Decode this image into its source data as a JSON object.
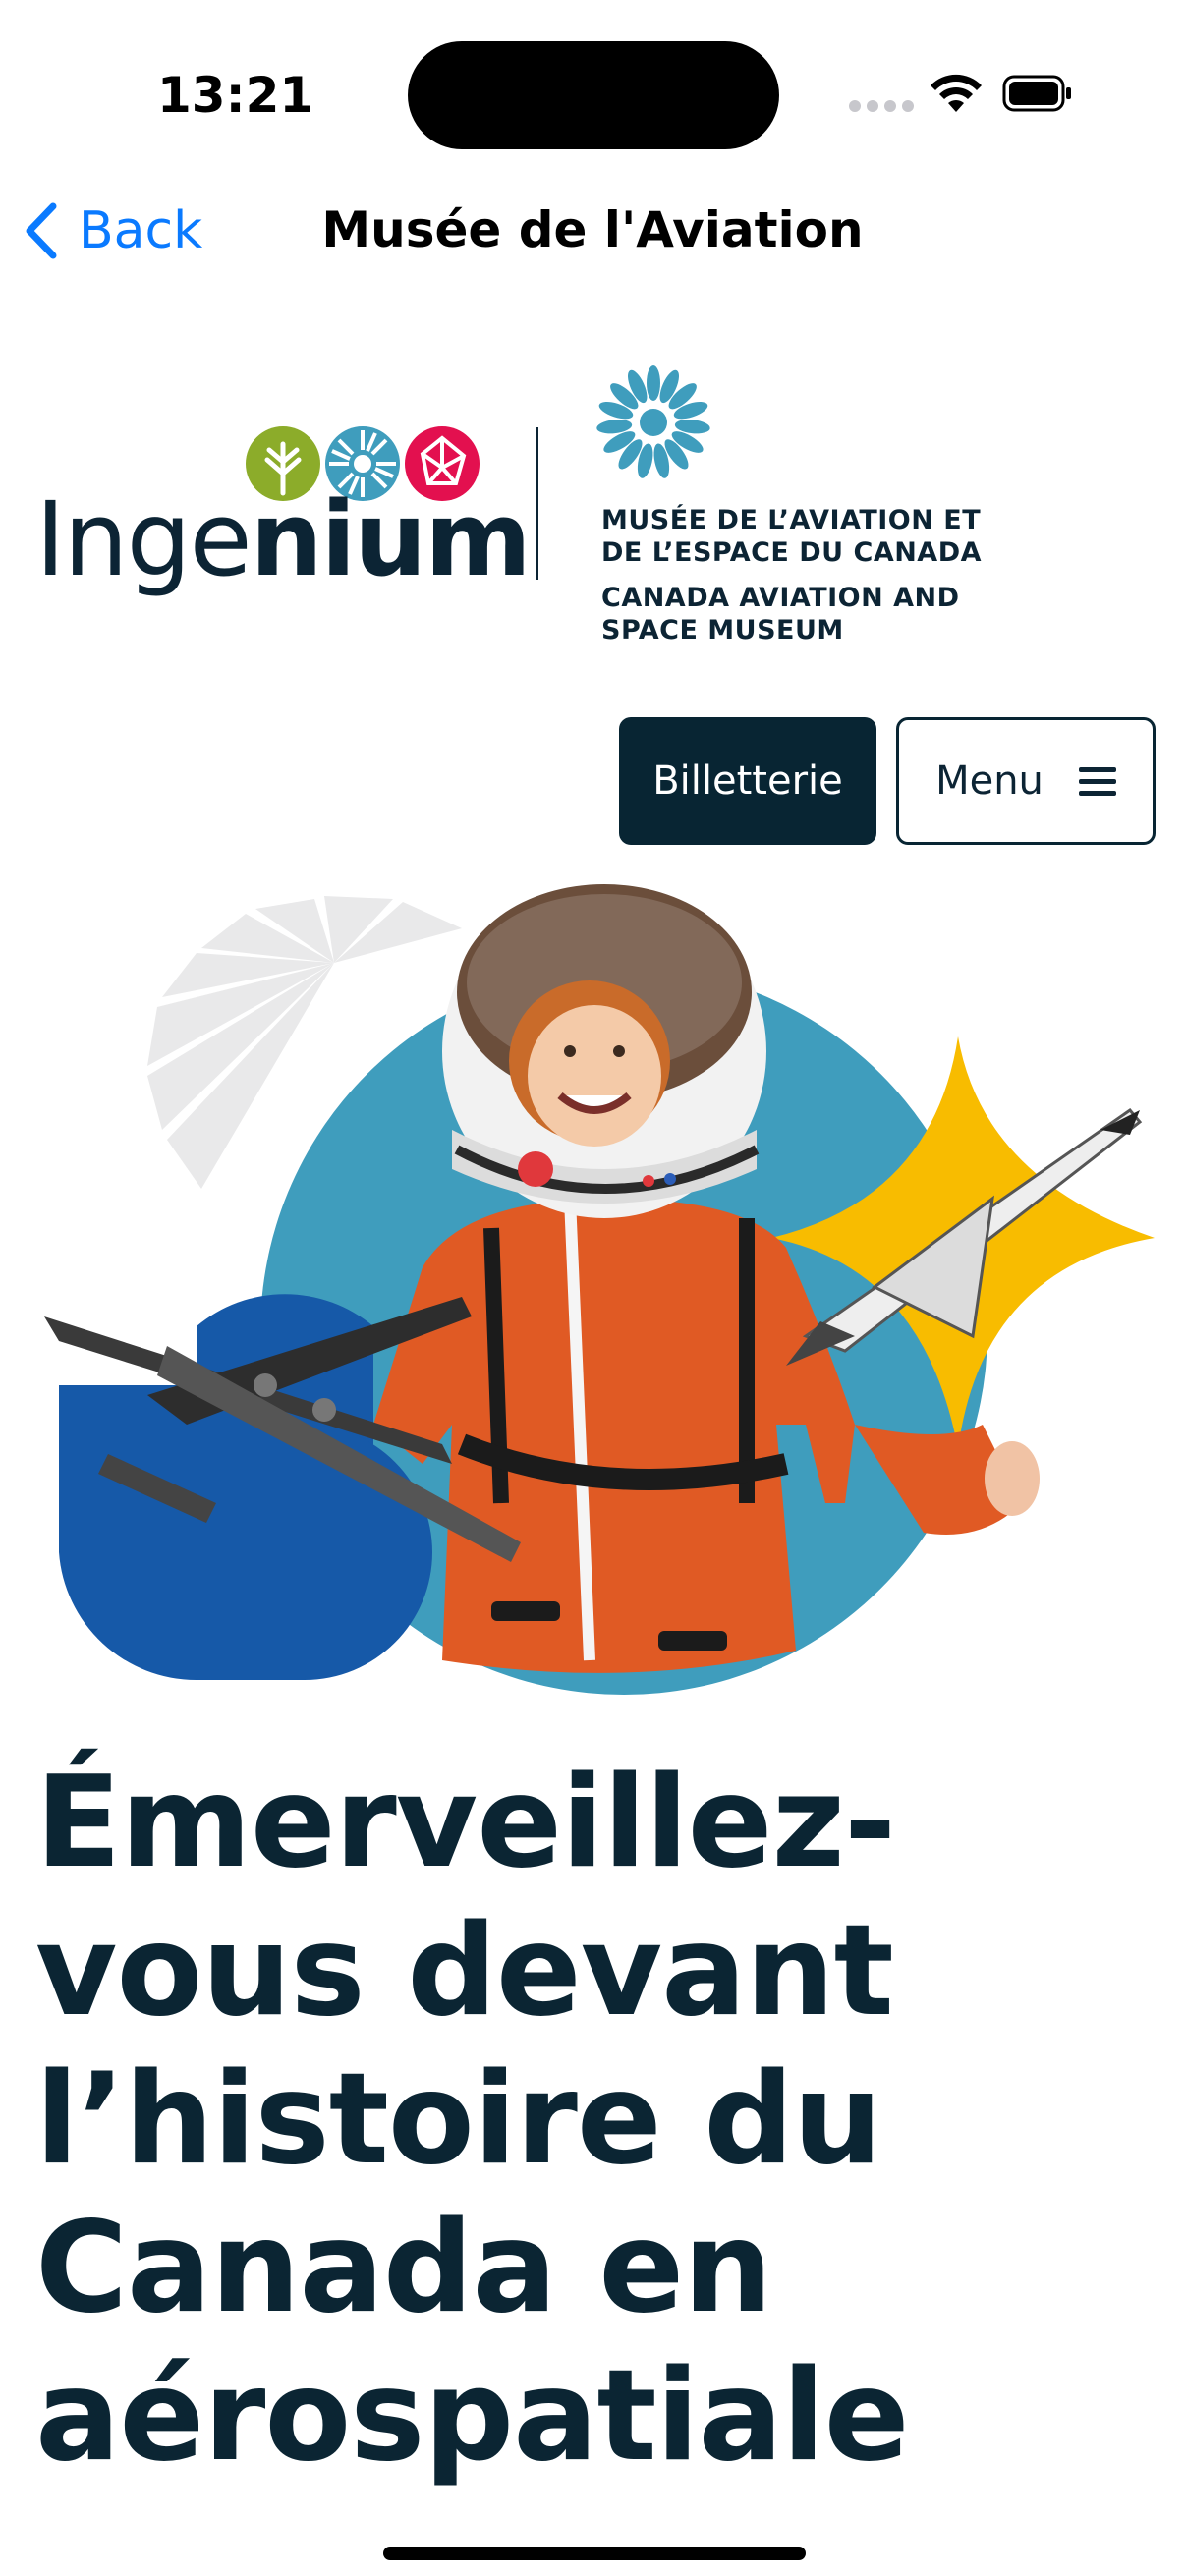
{
  "status_bar": {
    "time": "13:21"
  },
  "nav": {
    "back_label": "Back",
    "title": "Musée de l'Aviation"
  },
  "logo": {
    "ingenium_light": "Inge",
    "ingenium_bold": "nium",
    "museum_fr_line1": "MUSÉE DE L’AVIATION ET",
    "museum_fr_line2": "DE L’ESPACE DU CANADA",
    "museum_en_line1": "CANADA AVIATION AND",
    "museum_en_line2": "SPACE MUSEUM"
  },
  "header_buttons": {
    "tickets_label": "Billetterie",
    "menu_label": "Menu"
  },
  "hero": {
    "headline_lines": [
      "Émerveillez-",
      "vous devant",
      "l’histoire du",
      "Canada en",
      "aérospatiale"
    ]
  },
  "colors": {
    "ios_blue": "#0a7aff",
    "navy": "#082533",
    "teal_circle": "#3f9dbd",
    "royal_blue": "#1659a8",
    "gold_star": "#f8bc00",
    "leaf_green": "#8cac2a",
    "crimson": "#e3104f",
    "suit_orange": "#e05a24"
  }
}
